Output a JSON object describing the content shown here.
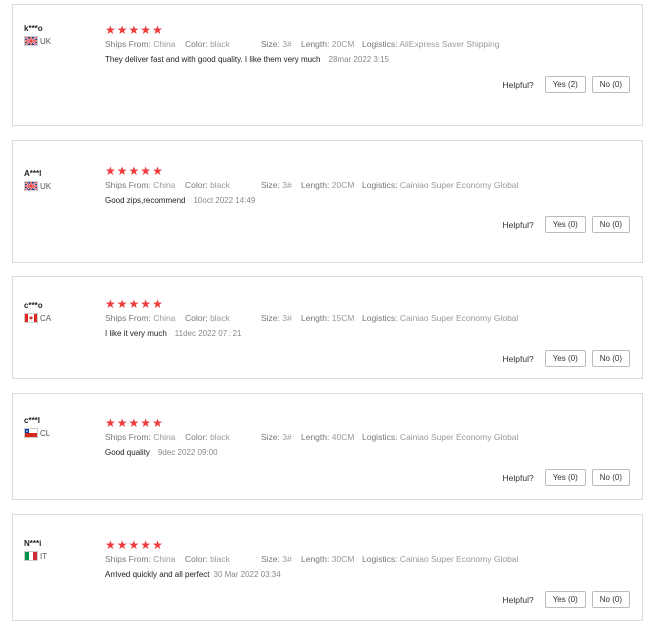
{
  "helpful_label": "Helpful?",
  "attr_labels": {
    "ships_from": "Ships From:",
    "color": "Color:",
    "size": "Size:",
    "length": "Length:",
    "logistics": "Logistics:"
  },
  "star_color": "#ee3a3a",
  "reviews": [
    {
      "user": "k***o",
      "country": "UK",
      "flag": "uk-flag-icon",
      "stars": 5,
      "ships_from": "China",
      "color": "black",
      "size": "3#",
      "length": "20CM",
      "logistics": "AliExpress Saver Shipping",
      "text": "They deliver fast and with good quality. I like them very much",
      "date": "28mar 2022 3:15",
      "yes": "Yes (2)",
      "no": "No (0)"
    },
    {
      "user": "A***l",
      "country": "UK",
      "flag": "uk-flag-icon",
      "stars": 5,
      "ships_from": "China",
      "color": "black",
      "size": "3#",
      "length": "20CM",
      "logistics": "Cainiao Super Economy Global",
      "text": "Good zips,recommend",
      "date": "10oct 2022 14:49",
      "yes": "Yes (0)",
      "no": "No (0)"
    },
    {
      "user": "c***o",
      "country": "CA",
      "flag": "ca-flag-icon",
      "stars": 5,
      "ships_from": "China",
      "color": "black",
      "size": "3#",
      "length": "15CM",
      "logistics": "Cainiao Super Economy Global",
      "text": "I like it very much",
      "date": "11dec 2022 07 : 21",
      "yes": "Yes (0)",
      "no": "No (0)"
    },
    {
      "user": "c***l",
      "country": "CL",
      "flag": "cl-flag-icon",
      "stars": 5,
      "ships_from": "China",
      "color": "black",
      "size": "3#",
      "length": "40CM",
      "logistics": "Cainiao Super Economy Global",
      "text": "Good quality",
      "date": "9dec 2022 09:00",
      "yes": "Yes (0)",
      "no": "No (0)"
    },
    {
      "user": "N***i",
      "country": "IT",
      "flag": "it-flag-icon",
      "stars": 5,
      "ships_from": "China",
      "color": "black",
      "size": "3#",
      "length": "30CM",
      "logistics": "Cainiao Super Economy Global",
      "text": "Arrived quickly and all perfect",
      "date": "30 Mar 2022 03:34",
      "yes": "Yes (0)",
      "no": "No (0)"
    }
  ]
}
